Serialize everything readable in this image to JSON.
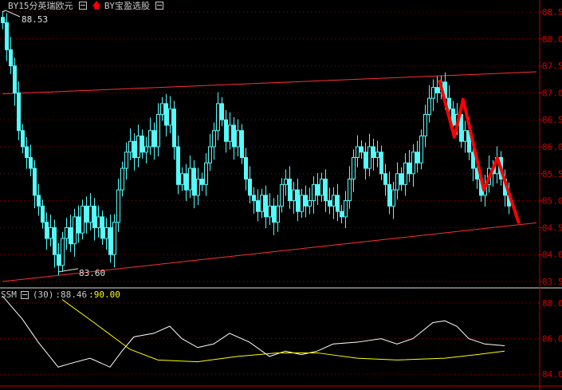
{
  "header": {
    "symbol": "BY15分英瑞欧元",
    "indicator": "BY宝盈选股",
    "arrow_icon": "up-arrow-icon"
  },
  "colors": {
    "candle": "#54fcfc",
    "trend": "#ff3030",
    "zigzag": "#ff0000",
    "axis": "#c00000",
    "grid": "#a00000",
    "ssm_white": "#ffffff",
    "ssm_yellow": "#ffff00"
  },
  "chart_data": [
    {
      "type": "candlestick",
      "ylim": [
        83.5,
        88.6
      ],
      "yticks": [
        "88.50",
        "88.00",
        "87.50",
        "87.00",
        "86.50",
        "86.00",
        "85.50",
        "85.00",
        "84.50",
        "84.00",
        "83.50"
      ],
      "annotations": [
        {
          "text": "88.53",
          "index": 0
        },
        {
          "text": "83.60",
          "index": 14
        }
      ],
      "closes": [
        88.3,
        87.8,
        87.5,
        87.0,
        86.3,
        86.0,
        85.8,
        85.6,
        85.1,
        84.9,
        84.6,
        84.3,
        84.5,
        84.0,
        83.8,
        84.3,
        84.5,
        84.2,
        84.7,
        84.4,
        84.9,
        84.6,
        84.9,
        84.5,
        84.7,
        84.3,
        84.5,
        84.0,
        84.6,
        85.2,
        85.6,
        85.9,
        86.1,
        85.8,
        86.2,
        85.9,
        86.0,
        86.3,
        86.0,
        86.6,
        86.8,
        86.4,
        86.7,
        86.0,
        85.3,
        85.5,
        85.2,
        85.6,
        85.1,
        85.4,
        85.3,
        85.7,
        86.0,
        86.3,
        86.8,
        86.5,
        86.1,
        86.4,
        86.0,
        86.3,
        85.8,
        85.4,
        85.1,
        85.0,
        84.8,
        85.1,
        84.7,
        84.9,
        84.6,
        84.9,
        85.3,
        85.4,
        85.0,
        85.2,
        84.8,
        85.1,
        84.9,
        85.0,
        85.3,
        85.1,
        85.4,
        85.0,
        84.9,
        85.1,
        84.8,
        84.7,
        85.0,
        85.4,
        85.8,
        86.0,
        85.9,
        85.6,
        86.0,
        85.8,
        85.9,
        85.5,
        85.3,
        84.9,
        85.2,
        85.5,
        85.3,
        85.7,
        85.5,
        85.9,
        85.7,
        86.2,
        86.6,
        86.9,
        87.1,
        87.0,
        87.2,
        86.9,
        86.7,
        86.4,
        86.6,
        86.1,
        86.3,
        85.9,
        85.6,
        85.4,
        85.1,
        85.3,
        85.6,
        85.5,
        85.8,
        85.4,
        85.1,
        84.9
      ],
      "trendlines": [
        {
          "from": [
            0,
            86.98
          ],
          "to": [
            134,
            87.39
          ]
        },
        {
          "from": [
            0,
            83.5
          ],
          "to": [
            134,
            84.59
          ]
        }
      ],
      "zigzag": [
        [
          109.6,
          87.24
        ],
        [
          113.4,
          86.18
        ],
        [
          115.6,
          86.88
        ],
        [
          120.8,
          85.2
        ],
        [
          124.2,
          85.79
        ],
        [
          129.6,
          84.58
        ]
      ]
    },
    {
      "type": "line",
      "name": "SSM",
      "param": "(30)",
      "values_label": [
        ":88.46",
        ":90.00"
      ],
      "ylim": [
        83.5,
        88.5
      ],
      "yticks": [
        "88.00",
        "86.00",
        "84.00"
      ],
      "series": [
        {
          "points": [
            [
              0,
              88.4
            ],
            [
              5,
              87.1
            ],
            [
              9,
              85.8
            ],
            [
              14,
              84.4
            ],
            [
              17,
              84.6
            ],
            [
              22,
              84.9
            ],
            [
              27,
              84.4
            ],
            [
              30,
              85.3
            ],
            [
              33,
              86.1
            ],
            [
              38,
              86.3
            ],
            [
              42,
              86.7
            ],
            [
              45,
              86.0
            ],
            [
              49,
              85.5
            ],
            [
              53,
              85.7
            ],
            [
              57,
              86.3
            ],
            [
              62,
              85.8
            ],
            [
              67,
              85.0
            ],
            [
              71,
              85.3
            ],
            [
              75,
              85.1
            ],
            [
              79,
              85.3
            ],
            [
              83,
              85.7
            ],
            [
              89,
              85.8
            ],
            [
              95,
              86.0
            ],
            [
              99,
              85.7
            ],
            [
              103,
              86.0
            ],
            [
              108,
              86.9
            ],
            [
              111,
              87.0
            ],
            [
              114,
              86.7
            ],
            [
              117,
              86.0
            ],
            [
              121,
              85.7
            ],
            [
              126,
              85.6
            ]
          ]
        },
        {
          "points": [
            [
              15,
              88.2
            ],
            [
              23,
              86.9
            ],
            [
              32,
              85.4
            ],
            [
              39,
              84.8
            ],
            [
              49,
              84.7
            ],
            [
              59,
              85.0
            ],
            [
              69,
              85.2
            ],
            [
              79,
              85.2
            ],
            [
              89,
              84.9
            ],
            [
              99,
              84.8
            ],
            [
              111,
              84.9
            ],
            [
              119,
              85.1
            ],
            [
              126,
              85.3
            ]
          ]
        }
      ]
    }
  ]
}
